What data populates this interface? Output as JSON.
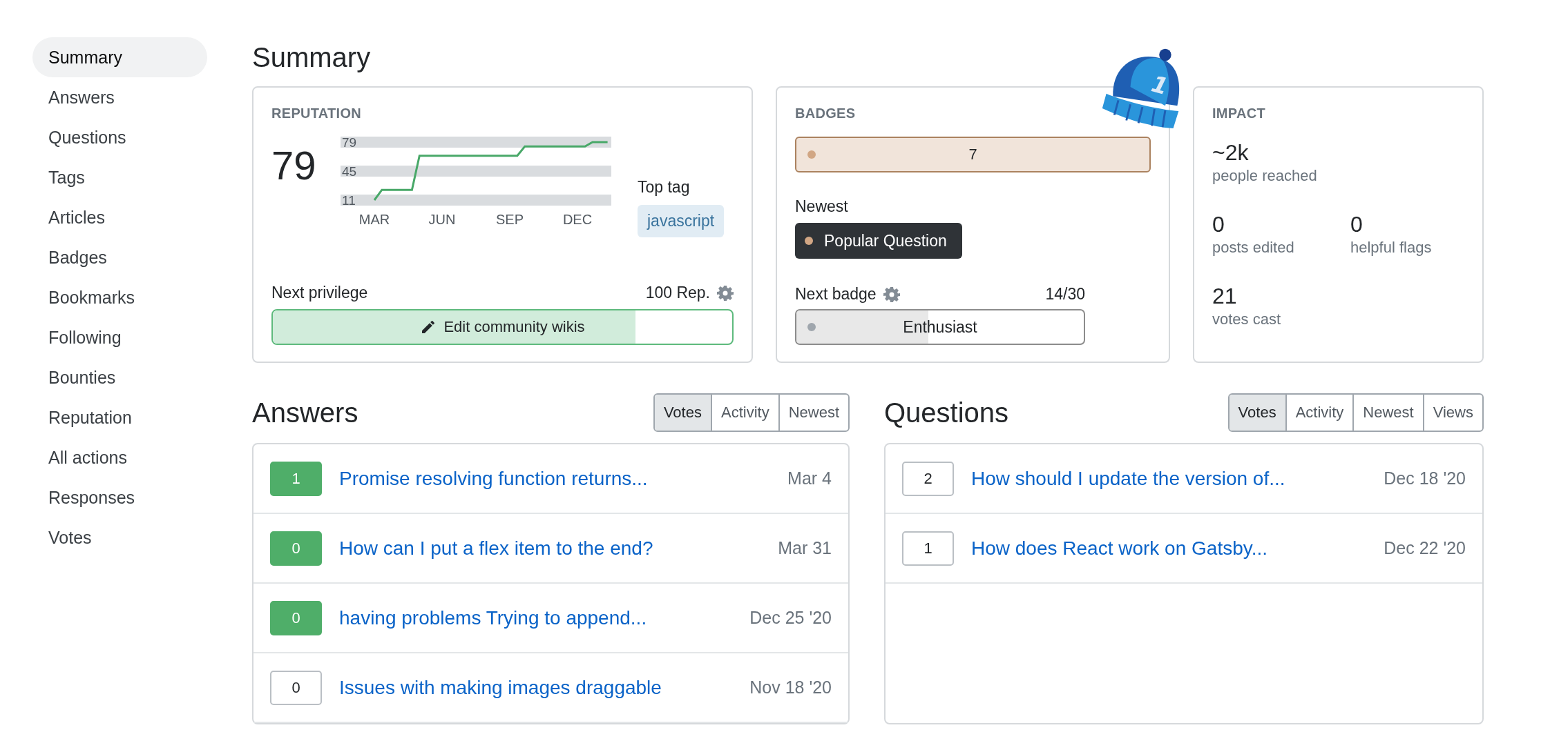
{
  "sidebar": {
    "items": [
      {
        "label": "Summary",
        "selected": true
      },
      {
        "label": "Answers",
        "selected": false
      },
      {
        "label": "Questions",
        "selected": false
      },
      {
        "label": "Tags",
        "selected": false
      },
      {
        "label": "Articles",
        "selected": false
      },
      {
        "label": "Badges",
        "selected": false
      },
      {
        "label": "Bookmarks",
        "selected": false
      },
      {
        "label": "Following",
        "selected": false
      },
      {
        "label": "Bounties",
        "selected": false
      },
      {
        "label": "Reputation",
        "selected": false
      },
      {
        "label": "All actions",
        "selected": false
      },
      {
        "label": "Responses",
        "selected": false
      },
      {
        "label": "Votes",
        "selected": false
      }
    ]
  },
  "title": "Summary",
  "hat": {
    "label": "1"
  },
  "reputation": {
    "label": "REPUTATION",
    "value": "79",
    "chart_data": {
      "type": "line",
      "categories": [
        null,
        null,
        null,
        null,
        "MAR",
        null,
        null,
        null,
        null,
        null,
        null,
        null,
        null,
        "JUN",
        null,
        null,
        null,
        null,
        null,
        null,
        null,
        null,
        "SEP",
        null,
        null,
        null,
        null,
        null,
        null,
        null,
        null,
        "DEC",
        null,
        null,
        null,
        null
      ],
      "series": [
        {
          "color": "#48a868",
          "values": [
            null,
            null,
            null,
            null,
            11,
            23,
            23,
            23,
            23,
            23,
            63,
            63,
            63,
            63,
            63,
            63,
            63,
            63,
            63,
            63,
            63,
            63,
            63,
            63,
            74,
            74,
            74,
            74,
            74,
            74,
            74,
            74,
            74,
            79,
            79,
            79
          ]
        }
      ],
      "ylim": [
        11,
        79
      ],
      "yticks": [
        11,
        45,
        79
      ]
    },
    "top_tag_label": "Top tag",
    "top_tag": "javascript",
    "next_privilege_label": "Next privilege",
    "next_privilege_rep": "100 Rep.",
    "privilege": {
      "name": "Edit community wikis",
      "level": 0.79
    }
  },
  "badges": {
    "label": "BADGES",
    "counts": [
      {
        "kind": "bronze",
        "count": "7"
      }
    ],
    "newest_label": "Newest",
    "newest": {
      "name": "Popular Question",
      "kind": "bronze"
    },
    "next_badge_label": "Next badge",
    "next_badge_progress": "14/30",
    "next_badge": {
      "name": "Enthusiast",
      "kind": "silver",
      "level": 0.46
    }
  },
  "impact": {
    "label": "IMPACT",
    "stats": [
      {
        "value": "~2k",
        "label": "people reached"
      },
      {
        "value": "0",
        "label": "posts edited"
      },
      {
        "value": "0",
        "label": "helpful flags"
      },
      {
        "value": "21",
        "label": "votes cast"
      }
    ]
  },
  "answers": {
    "title": "Answers",
    "tabs": [
      {
        "label": "Votes",
        "selected": true
      },
      {
        "label": "Activity",
        "selected": false
      },
      {
        "label": "Newest",
        "selected": false
      }
    ],
    "items": [
      {
        "score": "1",
        "accepted": true,
        "title": "Promise resolving function returns...",
        "date": "Mar 4"
      },
      {
        "score": "0",
        "accepted": true,
        "title": "How can I put a flex item to the end?",
        "date": "Mar 31"
      },
      {
        "score": "0",
        "accepted": true,
        "title": "having problems Trying to append...",
        "date": "Dec 25 '20"
      },
      {
        "score": "0",
        "accepted": false,
        "title": "Issues with making images draggable",
        "date": "Nov 18 '20"
      }
    ]
  },
  "questions": {
    "title": "Questions",
    "tabs": [
      {
        "label": "Votes",
        "selected": true
      },
      {
        "label": "Activity",
        "selected": false
      },
      {
        "label": "Newest",
        "selected": false
      },
      {
        "label": "Views",
        "selected": false
      }
    ],
    "items": [
      {
        "score": "2",
        "accepted": false,
        "title": "How should I update the version of...",
        "date": "Dec 18 '20"
      },
      {
        "score": "1",
        "accepted": false,
        "title": "How does React work on Gatsby...",
        "date": "Dec 22 '20"
      }
    ]
  }
}
